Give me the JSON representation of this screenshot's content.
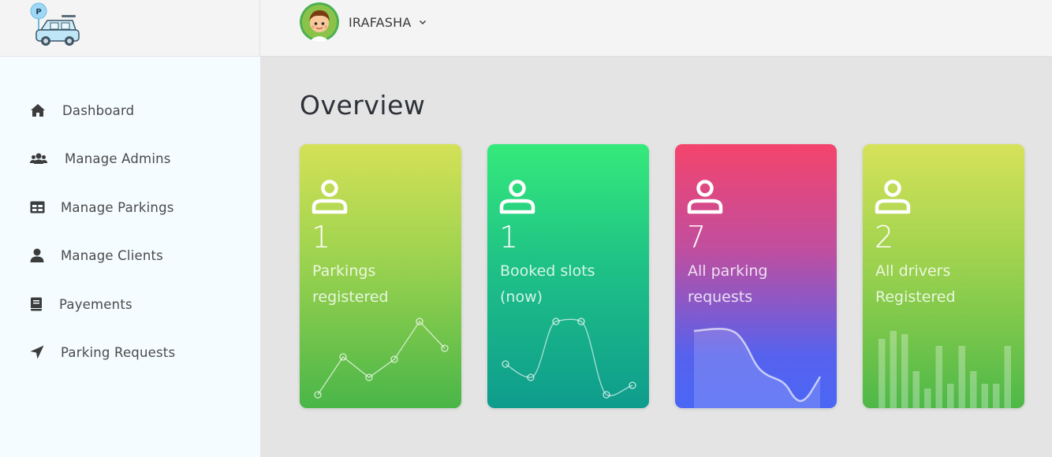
{
  "header": {
    "user_name": "IRAFASHA",
    "logo_icon": "parking-car-logo",
    "avatar_icon": "boy-avatar",
    "caret_icon": "chevron-down-icon"
  },
  "sidebar": {
    "items": [
      {
        "label": "Dashboard",
        "icon": "home-icon"
      },
      {
        "label": "Manage Admins",
        "icon": "users-icon"
      },
      {
        "label": "Manage Parkings",
        "icon": "table-icon"
      },
      {
        "label": "Manage Clients",
        "icon": "user-icon"
      },
      {
        "label": "Payements",
        "icon": "book-icon"
      },
      {
        "label": "Parking Requests",
        "icon": "location-arrow-icon"
      }
    ]
  },
  "main": {
    "title": "Overview",
    "cards": [
      {
        "count": "1",
        "label": "Parkings registered",
        "icon": "user-outline-icon"
      },
      {
        "count": "1",
        "label": "Booked slots (now)",
        "icon": "user-outline-icon"
      },
      {
        "count": "7",
        "label": "All parking requests",
        "icon": "user-outline-icon"
      },
      {
        "count": "2",
        "label": "All drivers Registered",
        "icon": "user-outline-icon"
      }
    ]
  },
  "colors": {
    "sidebar_bg": "#f4fcff",
    "main_bg": "#e4e4e4",
    "card1": "#9bd24f",
    "card2": "#1fc286",
    "card3": "#c04e9f",
    "card4": "#9dd24e"
  }
}
